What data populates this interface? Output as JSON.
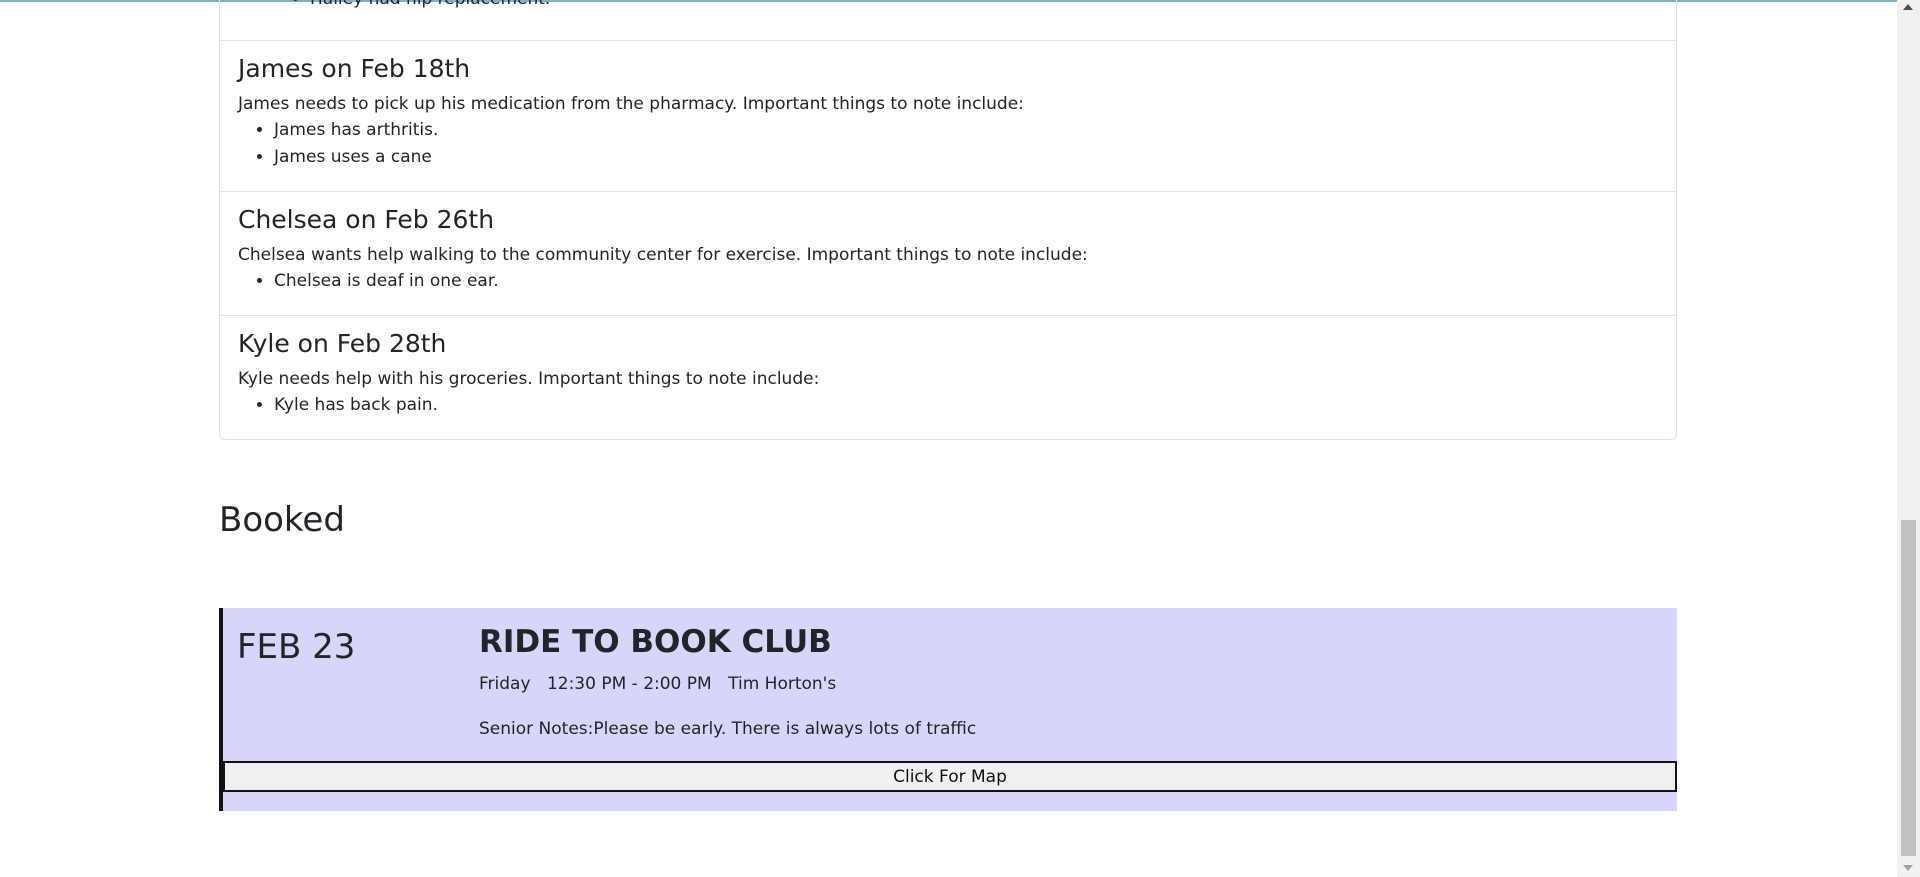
{
  "requests": [
    {
      "title": "",
      "description": "",
      "notes": [
        "Hailey had hip replacement."
      ]
    },
    {
      "title": "James on Feb 18th",
      "description": "James needs to pick up his medication from the pharmacy. Important things to note include:",
      "notes": [
        "James has arthritis.",
        "James uses a cane"
      ]
    },
    {
      "title": "Chelsea on Feb 26th",
      "description": "Chelsea wants help walking to the community center for exercise. Important things to note include:",
      "notes": [
        "Chelsea is deaf in one ear."
      ]
    },
    {
      "title": "Kyle on Feb 28th",
      "description": "Kyle needs help with his groceries. Important things to note include:",
      "notes": [
        "Kyle has back pain."
      ]
    }
  ],
  "booked": {
    "heading": "Booked",
    "card": {
      "date": "FEB 23",
      "title": "RIDE TO BOOK CLUB",
      "day": "Friday",
      "time": "12:30 PM - 2:00 PM",
      "location": "Tim Horton's",
      "notes": "Senior Notes:Please be early. There is always lots of traffic",
      "map_button": "Click For Map"
    }
  },
  "colors": {
    "card_background": "#d6d6fa",
    "card_border": "#111111",
    "top_line": "#7fb3c4"
  }
}
